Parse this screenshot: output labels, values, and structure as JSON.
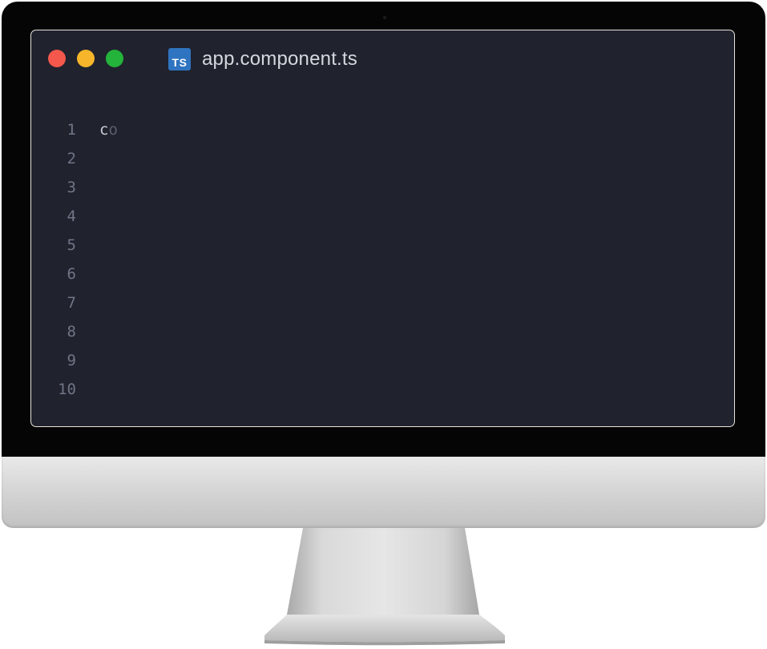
{
  "editor": {
    "tab": {
      "icon": "typescript-file-icon",
      "icon_text": "TS",
      "filename": "app.component.ts"
    },
    "window_controls": [
      "close",
      "minimize",
      "maximize"
    ],
    "line_numbers": [
      "1",
      "2",
      "3",
      "4",
      "5",
      "6",
      "7",
      "8",
      "9",
      "10"
    ],
    "lines": [
      {
        "typed": "c",
        "ghost": "o"
      },
      {
        "typed": "",
        "ghost": ""
      },
      {
        "typed": "",
        "ghost": ""
      },
      {
        "typed": "",
        "ghost": ""
      },
      {
        "typed": "",
        "ghost": ""
      },
      {
        "typed": "",
        "ghost": ""
      },
      {
        "typed": "",
        "ghost": ""
      },
      {
        "typed": "",
        "ghost": ""
      },
      {
        "typed": "",
        "ghost": ""
      },
      {
        "typed": "",
        "ghost": ""
      }
    ]
  },
  "colors": {
    "editor_background": "#20222e",
    "close": "#f4574b",
    "minimize": "#f6b52a",
    "maximize": "#24b33b",
    "typescript_blue": "#2f74c0"
  }
}
